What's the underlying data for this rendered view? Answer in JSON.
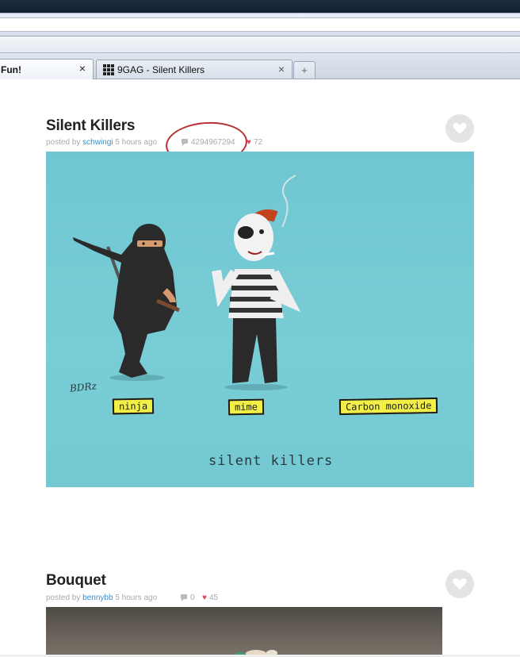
{
  "browser": {
    "tabs": [
      {
        "label": "Fun!",
        "active": true
      },
      {
        "label": "9GAG - Silent Killers",
        "active": false
      }
    ],
    "close_glyph": "×",
    "new_tab_glyph": "+"
  },
  "posts": [
    {
      "title": "Silent Killers",
      "posted_by_prefix": "posted by",
      "author": "schwingi",
      "time": "5 hours ago",
      "comments": "4294967294",
      "likes": "72",
      "image": {
        "labels": [
          "ninja",
          "mime",
          "Carbon monoxide"
        ],
        "caption": "silent killers",
        "signature": "BDRz"
      }
    },
    {
      "title": "Bouquet",
      "posted_by_prefix": "posted by",
      "author": "bennybb",
      "time": "5 hours ago",
      "comments": "0",
      "likes": "45"
    }
  ],
  "colors": {
    "accent_link": "#3b8cc4",
    "heart": "#e0465c",
    "annotation": "#b73033",
    "image_bg": "#74c9d3"
  }
}
